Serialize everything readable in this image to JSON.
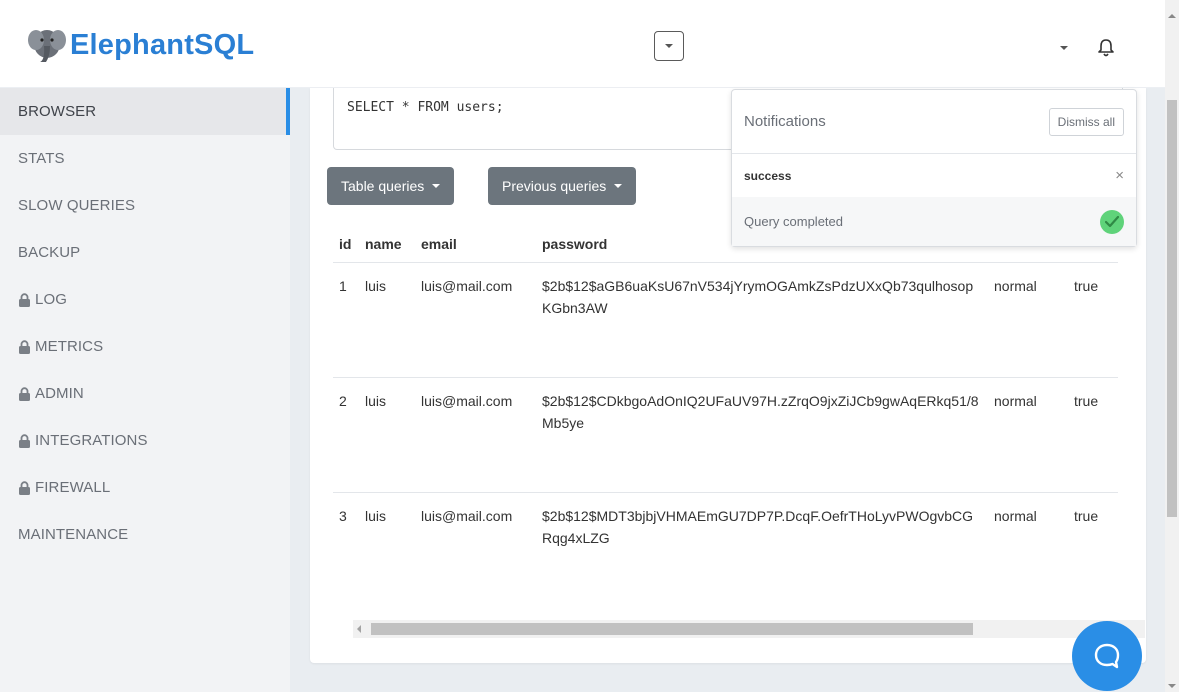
{
  "brand": {
    "name": "ElephantSQL"
  },
  "header": {
    "center_dropdown_icon": "caret-down-icon",
    "account_dropdown_icon": "caret-down-icon",
    "bell_icon": "bell-icon"
  },
  "sidebar": {
    "items": [
      {
        "label": "BROWSER",
        "locked": false,
        "active": true
      },
      {
        "label": "STATS",
        "locked": false,
        "active": false
      },
      {
        "label": "SLOW QUERIES",
        "locked": false,
        "active": false
      },
      {
        "label": "BACKUP",
        "locked": false,
        "active": false
      },
      {
        "label": "LOG",
        "locked": true,
        "active": false
      },
      {
        "label": "METRICS",
        "locked": true,
        "active": false
      },
      {
        "label": "ADMIN",
        "locked": true,
        "active": false
      },
      {
        "label": "INTEGRATIONS",
        "locked": true,
        "active": false
      },
      {
        "label": "FIREWALL",
        "locked": true,
        "active": false
      },
      {
        "label": "MAINTENANCE",
        "locked": false,
        "active": false
      }
    ]
  },
  "query": {
    "text": "SELECT * FROM users;"
  },
  "buttons": {
    "table_queries": "Table queries",
    "previous_queries": "Previous queries"
  },
  "table": {
    "columns": [
      "id",
      "name",
      "email",
      "password",
      "",
      ""
    ],
    "rows": [
      [
        "1",
        "luis",
        "luis@mail.com",
        "$2b$12$aGB6uaKsU67nV534jYrymOGAmkZsPdzUXxQb73qulhosopKGbn3AW",
        "normal",
        "true"
      ],
      [
        "2",
        "luis",
        "luis@mail.com",
        "$2b$12$CDkbgoAdOnIQ2UFaUV97H.zZrqO9jxZiJCb9gwAqERkq51/8Mb5ye",
        "normal",
        "true"
      ],
      [
        "3",
        "luis",
        "luis@mail.com",
        "$2b$12$MDT3bjbjVHMAEmGU7DP7P.DcqF.OefrTHoLyvPWOgvbCGRqg4xLZG",
        "normal",
        "true"
      ]
    ]
  },
  "notifications": {
    "title": "Notifications",
    "dismiss_label": "Dismiss all",
    "items": [
      {
        "type": "success",
        "message": "Query completed",
        "icon": "check-circle-icon",
        "close": "×"
      }
    ]
  },
  "colors": {
    "brand": "#2a7fd4",
    "accent": "#2a8ee6",
    "button": "#6c757d",
    "success": "#5fd37a",
    "sidebar_bg": "#f2f3f5"
  }
}
